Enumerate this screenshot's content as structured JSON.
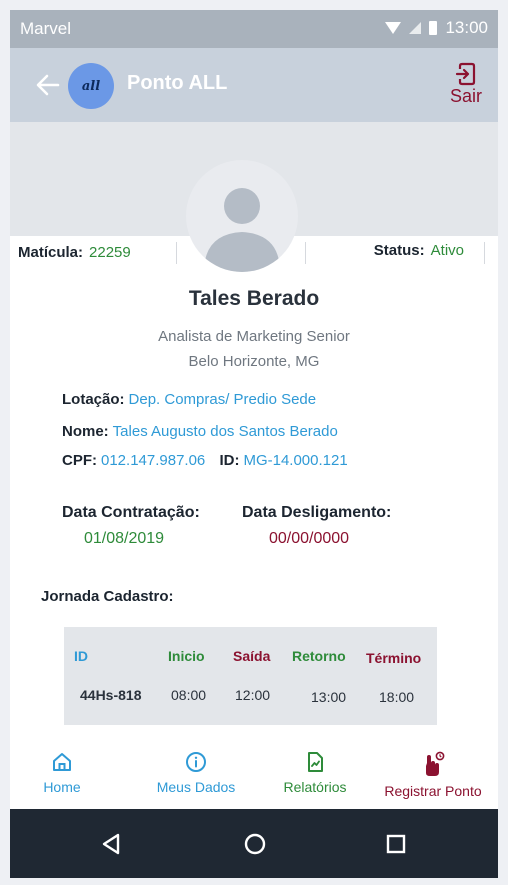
{
  "statusbar": {
    "carrier": "Marvel",
    "time": "13:00",
    "icons": [
      "wifi-icon",
      "signal-icon",
      "battery-icon"
    ]
  },
  "appbar": {
    "title": "Ponto ALL",
    "logo_text": "all",
    "exit_label": "Sair"
  },
  "profile": {
    "matricula_label": "Matícula:",
    "matricula_value": "22259",
    "status_label": "Status:",
    "status_value": "Ativo",
    "name": "Tales Berado",
    "role": "Analista de Marketing Senior",
    "city": "Belo Horizonte, MG"
  },
  "details": {
    "lotacao_label": "Lotação:",
    "lotacao_value": "Dep. Compras/ Predio Sede",
    "nome_label": "Nome:",
    "nome_value": "Tales Augusto dos Santos Berado",
    "cpf_label": "CPF:",
    "cpf_value": "012.147.987.06",
    "id_label": "ID:",
    "id_value": "MG-14.000.121"
  },
  "dates": {
    "contratacao_label": "Data Contratação:",
    "contratacao_value": "01/08/2019",
    "desligamento_label": "Data Desligamento:",
    "desligamento_value": "00/00/0000"
  },
  "jornada": {
    "label": "Jornada Cadastro:",
    "headers": {
      "id": "ID",
      "inicio": "Inicio",
      "saida": "Saída",
      "retorno": "Retorno",
      "termino": "Término"
    },
    "row": {
      "id": "44Hs-818",
      "inicio": "08:00",
      "saida": "12:00",
      "retorno": "13:00",
      "termino": "18:00"
    }
  },
  "bottom_nav": [
    {
      "label": "Home",
      "icon": "home-icon",
      "color": "#2f9ad6"
    },
    {
      "label": "Meus Dados",
      "icon": "info-icon",
      "color": "#2f9ad6"
    },
    {
      "label": "Relatórios",
      "icon": "report-icon",
      "color": "#2e8b3a"
    },
    {
      "label": "Registrar Ponto",
      "icon": "hand-clock-icon",
      "color": "#8b1230"
    }
  ],
  "colors": {
    "blue": "#2f9ad6",
    "green": "#2e8b3a",
    "red": "#8b1230",
    "appbar": "#c8d1dc",
    "sysnav": "#1f2833"
  }
}
